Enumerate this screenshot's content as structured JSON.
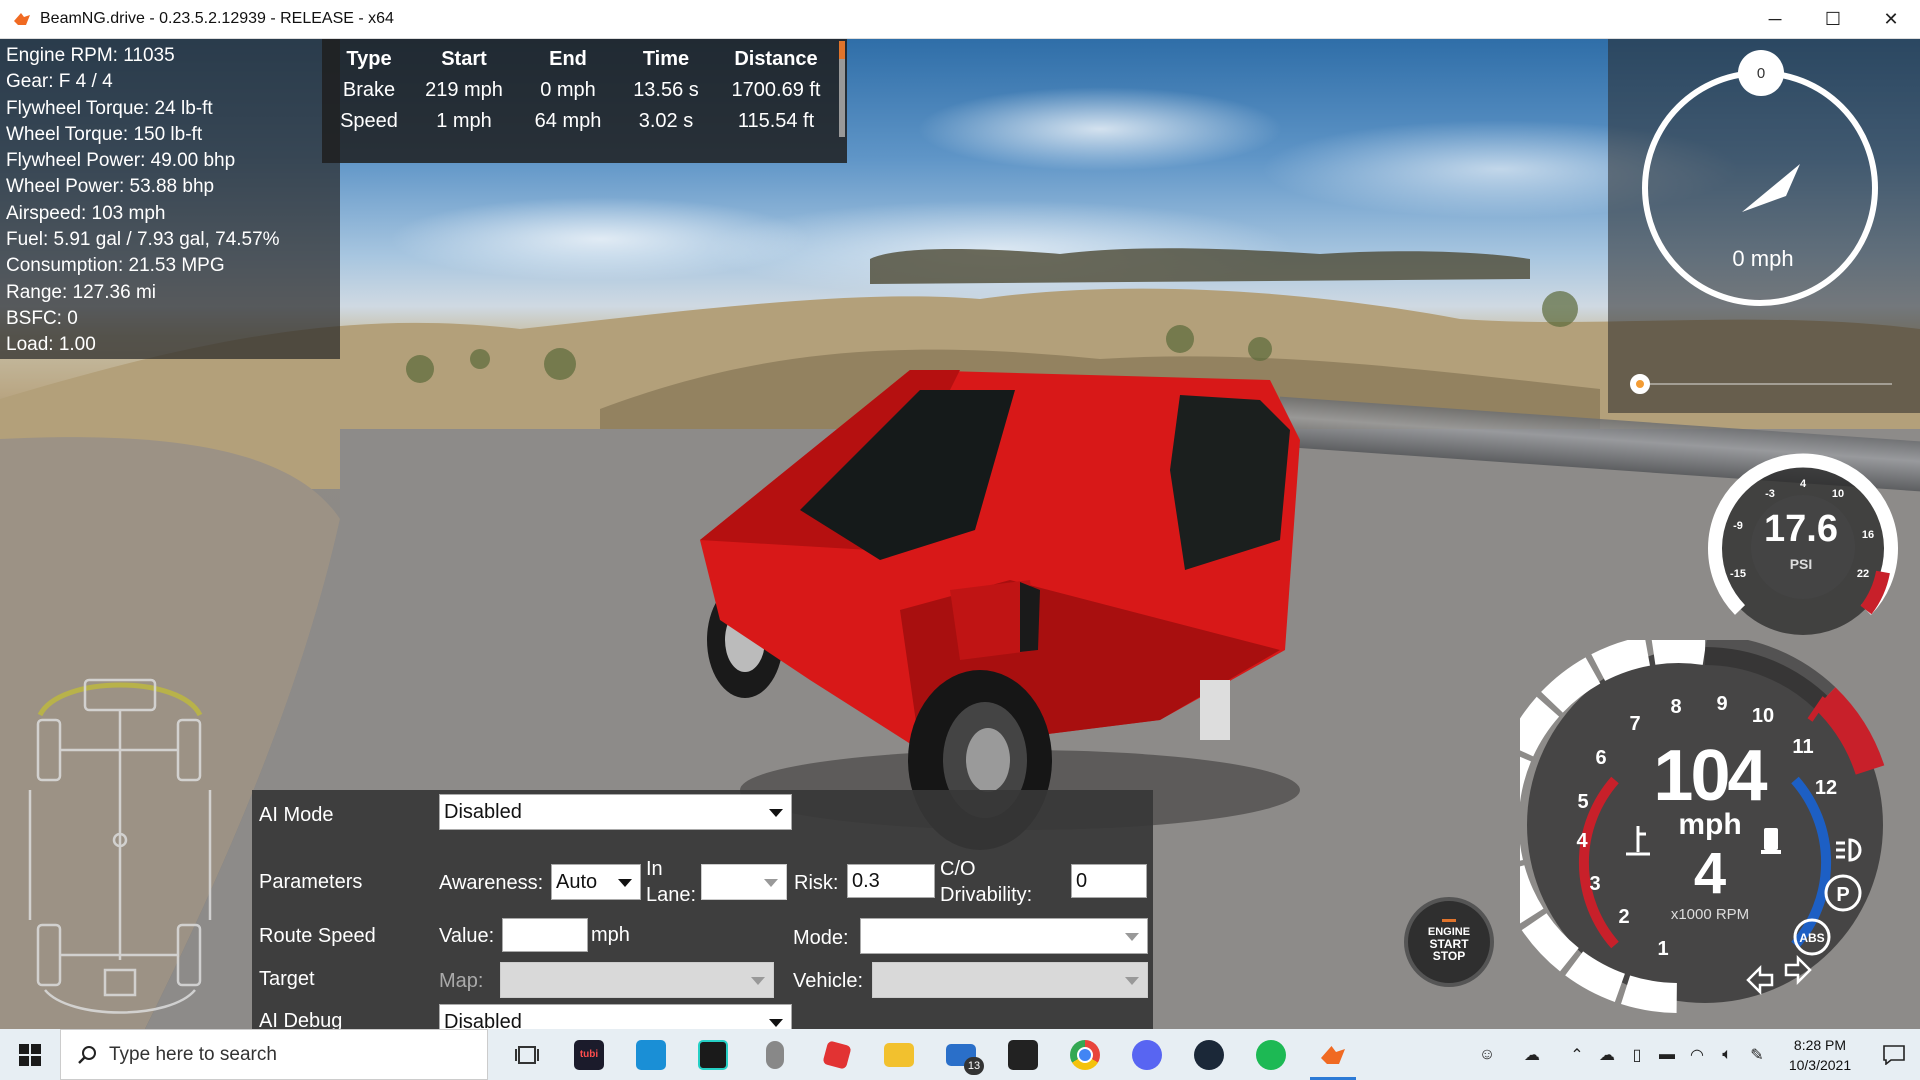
{
  "window": {
    "title": "BeamNG.drive - 0.23.5.2.12939 - RELEASE - x64",
    "minimize": "─",
    "maximize": "☐",
    "close": "✕"
  },
  "telemetry": {
    "lines": [
      "Engine RPM: 11035",
      "Gear: F 4 / 4",
      "Flywheel Torque: 24 lb-ft",
      "Wheel Torque: 150 lb-ft",
      "Flywheel Power: 49.00 bhp",
      "Wheel Power: 53.88 bhp",
      "Airspeed: 103 mph",
      "Fuel: 5.91 gal / 7.93 gal, 74.57%",
      "Consumption: 21.53 MPG",
      "Range: 127.36 mi",
      "BSFC: 0",
      "Load: 1.00"
    ]
  },
  "timing_table": {
    "headers": [
      "Type",
      "Start",
      "End",
      "Time",
      "Distance"
    ],
    "rows": [
      [
        "Brake",
        "219 mph",
        "0 mph",
        "13.56 s",
        "1700.69 ft"
      ],
      [
        "Speed",
        "1 mph",
        "64 mph",
        "3.02 s",
        "115.54 ft"
      ]
    ]
  },
  "navigation": {
    "top_value": "0",
    "speed": "0 mph",
    "slider_level": 0
  },
  "boost_gauge": {
    "value": "17.6",
    "unit": "PSI",
    "ticks": [
      "-15",
      "-9",
      "-3",
      "4",
      "10",
      "16",
      "22"
    ]
  },
  "speedometer": {
    "speed": "104",
    "unit": "mph",
    "gear": "4",
    "rpm_label": "x1000 RPM",
    "rpm_ticks": [
      "1",
      "2",
      "3",
      "4",
      "5",
      "6",
      "7",
      "8",
      "9",
      "10",
      "11",
      "12"
    ],
    "park_label": "P",
    "abs_label": "ABS"
  },
  "engine_button": {
    "line1": "ENGINE",
    "line2": "START",
    "line3": "STOP"
  },
  "ai_panel": {
    "ai_mode_label": "AI Mode",
    "ai_mode_value": "Disabled",
    "parameters_label": "Parameters",
    "awareness_label": "Awareness:",
    "awareness_value": "Auto",
    "in_lane_label_1": "In",
    "in_lane_label_2": "Lane:",
    "in_lane_value": "",
    "risk_label": "Risk:",
    "risk_value": "0.3",
    "co_label_1": "C/O",
    "co_label_2": "Drivability:",
    "co_value": "0",
    "route_speed_label": "Route Speed",
    "value_label": "Value:",
    "value_value": "",
    "value_unit": "mph",
    "mode_label": "Mode:",
    "mode_value": "",
    "target_label": "Target",
    "map_label": "Map:",
    "map_value": "",
    "vehicle_label": "Vehicle:",
    "vehicle_value": "",
    "ai_debug_label": "AI Debug",
    "ai_debug_value": "Disabled"
  },
  "taskbar": {
    "search_placeholder": "Type here to search",
    "apps": [
      {
        "name": "task-view",
        "color": "#333333"
      },
      {
        "name": "tubi",
        "color": "#1b1b2b",
        "label": "tubi"
      },
      {
        "name": "notes",
        "color": "#1a8fd6"
      },
      {
        "name": "audio-app",
        "color": "#1a1a1a"
      },
      {
        "name": "mouse-app",
        "color": "#888888"
      },
      {
        "name": "roblox",
        "color": "#e23333"
      },
      {
        "name": "file-explorer",
        "color": "#f2c12e"
      },
      {
        "name": "mail",
        "color": "#2a6fc9",
        "badge": "13"
      },
      {
        "name": "store",
        "color": "#222222"
      },
      {
        "name": "chrome",
        "color": "#e8453c"
      },
      {
        "name": "discord",
        "color": "#5865f2"
      },
      {
        "name": "steam",
        "color": "#1b2838"
      },
      {
        "name": "spotify",
        "color": "#1db954"
      },
      {
        "name": "beamng",
        "color": "#f06a22"
      }
    ],
    "time": "8:28 PM",
    "date": "10/3/2021"
  },
  "colors": {
    "accent_orange": "#e0742c",
    "redline": "#c8202a",
    "blue_arc": "#1d5fc4",
    "car_red": "#d81818"
  }
}
